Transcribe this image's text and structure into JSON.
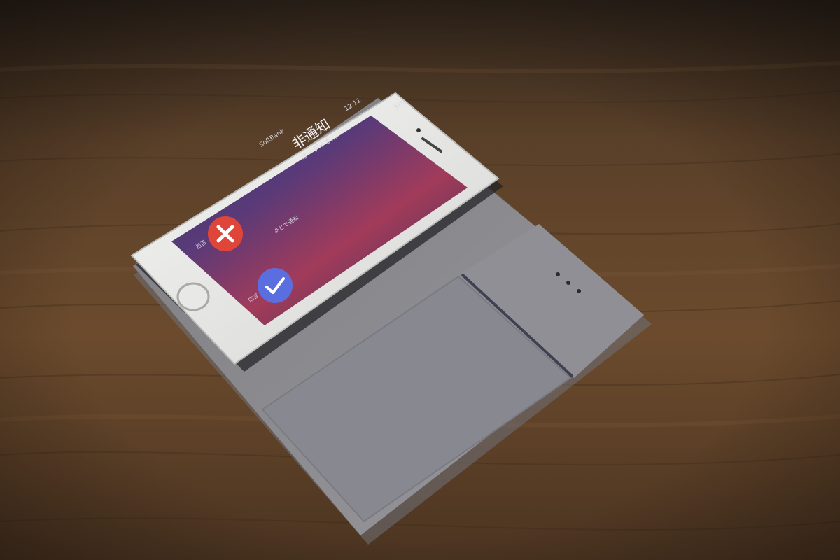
{
  "scene": {
    "description_visible_text": true
  },
  "phone": {
    "carrier": "SoftBank",
    "time": "12:11",
    "battery": "31%",
    "caller_name": "非通知",
    "call_type": "オーディオ...",
    "remind_label": "あとで通知",
    "decline_label": "拒否",
    "accept_label": "応答"
  },
  "colors": {
    "table": "#6b4a2c",
    "case": "#8f8f94",
    "phone_body": "#ececea",
    "decline": "#e0453a",
    "accept": "#5b6ee0"
  }
}
